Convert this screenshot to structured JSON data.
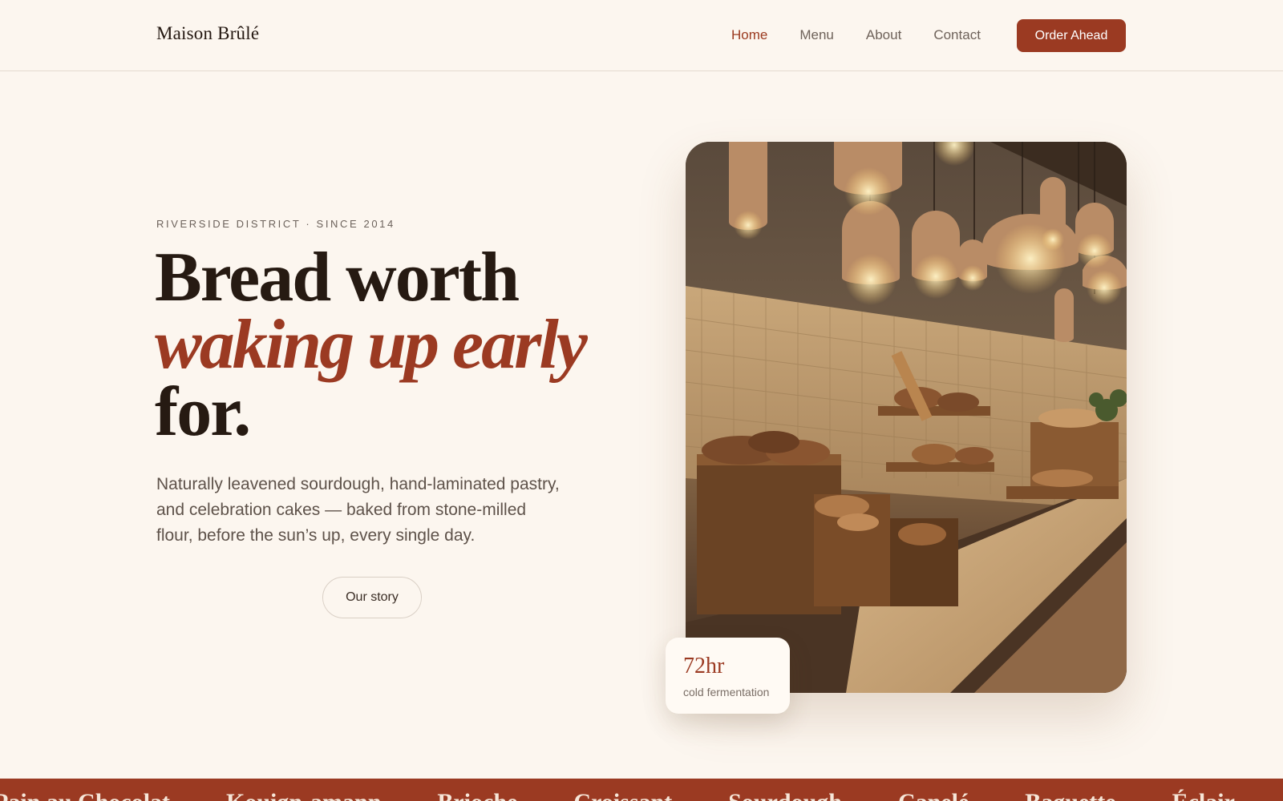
{
  "nav": {
    "brand": "Maison Brûlé",
    "links": [
      "Home",
      "Menu",
      "About",
      "Contact"
    ],
    "cta": "Order Ahead"
  },
  "hero": {
    "eyebrow": "RIVERSIDE DISTRICT · SINCE 2014",
    "headline_line1": "Bread worth",
    "headline_accent": "waking up early",
    "headline_line3": "for.",
    "lead": "Naturally leavened sourdough, hand-laminated pastry, and celebration cakes — baked from stone-milled flour, before the sun’s up, every single day.",
    "secondary_cta": "Our story"
  },
  "stat": {
    "value": "72hr",
    "label": "cold fermentation"
  },
  "ticker": {
    "items": [
      "Pain au Chocolat",
      "Kouign-amann",
      "Brioche",
      "Croissant",
      "Sourdough",
      "Canelé",
      "Baguette",
      "Éclair"
    ]
  },
  "colors": {
    "accent": "#9b3a22",
    "background": "#fcf6ef",
    "ink": "#261a12"
  }
}
